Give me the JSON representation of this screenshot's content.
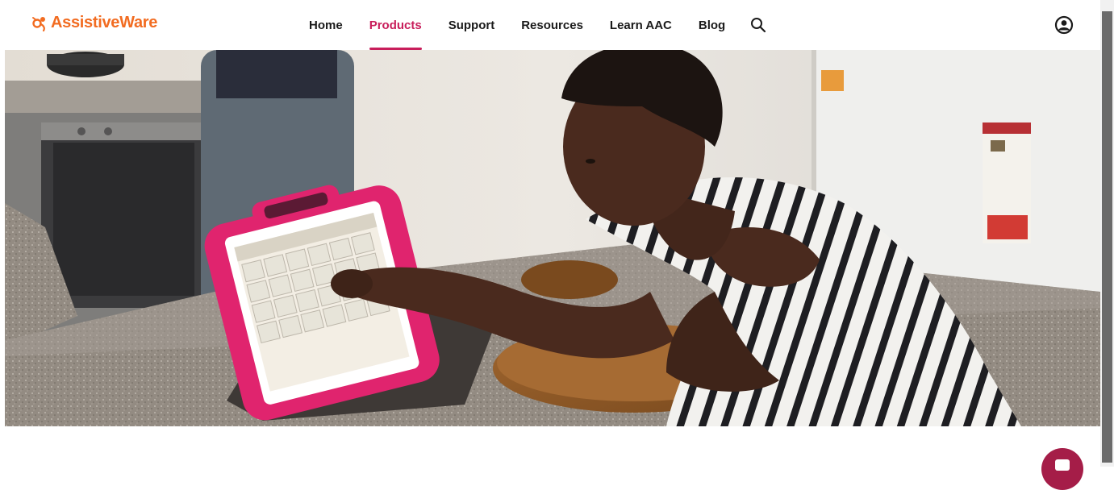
{
  "brand": {
    "name": "AssistiveWare",
    "name_part1": "Assistive",
    "name_part2": "Ware",
    "color": "#f26c21"
  },
  "nav": {
    "items": [
      {
        "label": "Home",
        "active": false
      },
      {
        "label": "Products",
        "active": true
      },
      {
        "label": "Support",
        "active": false
      },
      {
        "label": "Resources",
        "active": false
      },
      {
        "label": "Learn AAC",
        "active": false
      },
      {
        "label": "Blog",
        "active": false
      }
    ],
    "active_color": "#c81e5b",
    "search_icon": "search-icon",
    "account_icon": "account-icon"
  },
  "hero": {
    "image": "person-using-aac-tablet-in-kitchen"
  },
  "chat": {
    "icon": "chat-icon",
    "color": "#a51d48"
  }
}
